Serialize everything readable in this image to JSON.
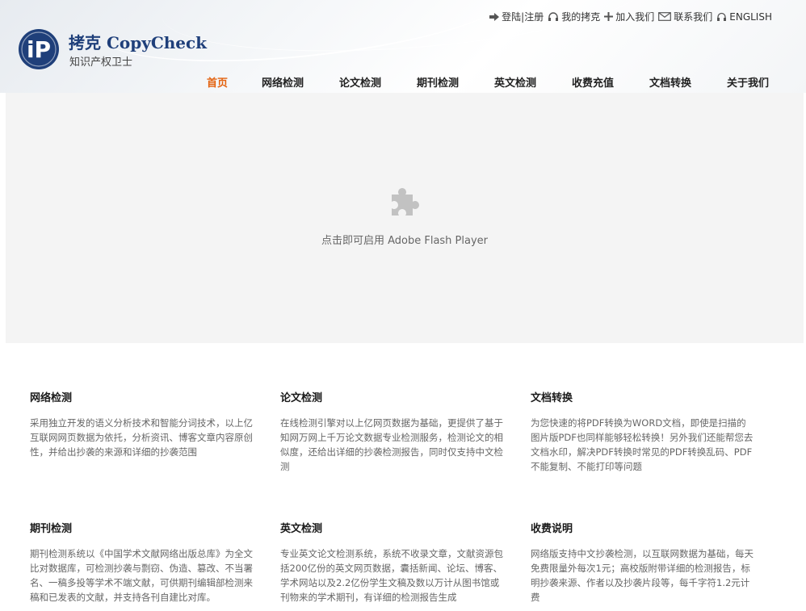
{
  "brand": {
    "name": "拷克 CopyCheck",
    "tagline": "知识产权卫士",
    "logo_text": "iP"
  },
  "toplinks": [
    {
      "icon": "arrow-right-icon",
      "label": "登陆|注册"
    },
    {
      "icon": "headset-icon",
      "label": "我的拷克"
    },
    {
      "icon": "plus-icon",
      "label": "加入我们"
    },
    {
      "icon": "envelope-icon",
      "label": "联系我们"
    },
    {
      "icon": "globe-icon",
      "label": "ENGLISH"
    }
  ],
  "nav": [
    {
      "label": "首页",
      "active": true
    },
    {
      "label": "网络检测"
    },
    {
      "label": "论文检测"
    },
    {
      "label": "期刊检测"
    },
    {
      "label": "英文检测"
    },
    {
      "label": "收费充值"
    },
    {
      "label": "文档转换"
    },
    {
      "label": "关于我们"
    }
  ],
  "flash": {
    "icon": "puzzle-icon",
    "message": "点击即可启用 Adobe Flash Player"
  },
  "cards": [
    {
      "title": "网络检测",
      "text": "采用独立开发的语义分析技术和智能分词技术，以上亿互联网网页数据为依托，分析资讯、博客文章内容原创性，并给出抄袭的来源和详细的抄袭范围"
    },
    {
      "title": "论文检测",
      "text": "在线检测引擎对以上亿网页数据为基础，更提供了基于知网万网上千万论文数据专业检测服务，检测论文的相似度，还给出详细的抄袭检测报告，同时仅支持中文检测"
    },
    {
      "title": "文档转换",
      "text": "为您快速的将PDF转换为WORD文档，即使是扫描的图片版PDF也同样能够轻松转换！另外我们还能帮您去文档水印，解决PDF转换时常见的PDF转换乱码、PDF不能复制、不能打印等问题"
    },
    {
      "title": "期刊检测",
      "text": "期刊检测系统以《中国学术文献网络出版总库》为全文比对数据库，可检测抄袭与剽窃、伪造、篡改、不当署名、一稿多投等学术不端文献，可供期刊编辑部检测来稿和已发表的文献，并支持各刊自建比对库。"
    },
    {
      "title": "英文检测",
      "text": "专业英文论文检测系统，系统不收录文章，文献资源包括200亿份的英文网页数据，囊括新闻、论坛、博客、学术网站以及2.2亿份学生文稿及数以万计从图书馆或刊物来的学术期刊，有详细的检测报告生成"
    },
    {
      "title": "收费说明",
      "text": "网络版支持中文抄袭检测，以互联网数据为基础，每天免费限量外每次1元；高校版附带详细的检测报告，标明抄袭来源、作者以及抄袭片段等，每千字符1.2元计费"
    }
  ],
  "colors": {
    "brand_blue": "#1f3f7a",
    "nav_active": "#e3620f",
    "flash_bg": "#f4f4f4",
    "puzzle_gray": "#c2c2c2"
  }
}
